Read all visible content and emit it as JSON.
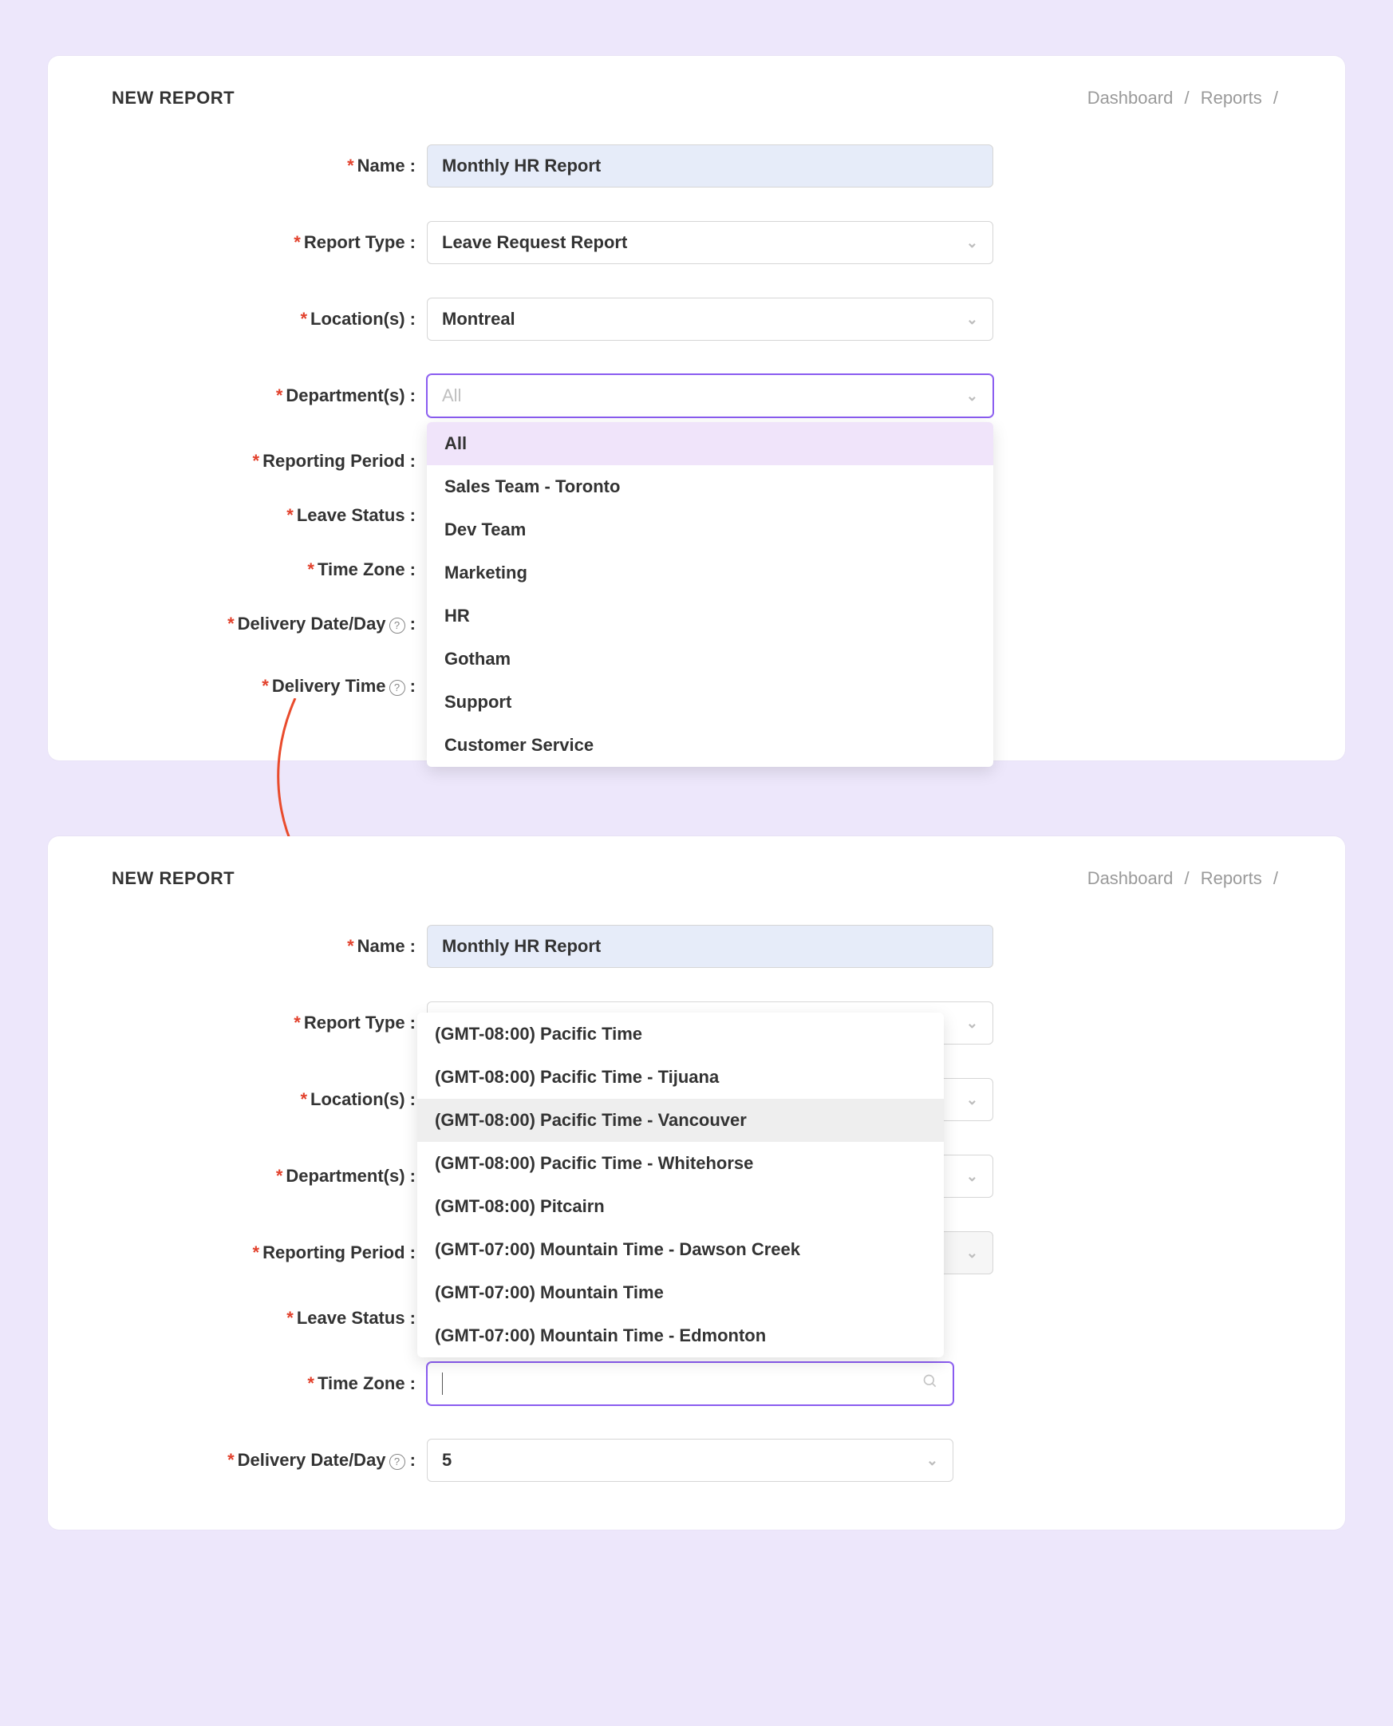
{
  "page_title": "NEW REPORT",
  "breadcrumb": {
    "a": "Dashboard",
    "sep": "/",
    "b": "Reports"
  },
  "labels": {
    "name": "Name :",
    "report_type": "Report Type :",
    "locations": "Location(s) :",
    "departments": "Department(s) :",
    "reporting_period": "Reporting Period :",
    "leave_status": "Leave Status :",
    "time_zone": "Time Zone :",
    "delivery_date": "Delivery Date/Day",
    "delivery_time": "Delivery Time"
  },
  "panel1": {
    "name_value": "Monthly HR Report",
    "report_type_value": "Leave Request Report",
    "locations_value": "Montreal",
    "departments_placeholder": "All",
    "department_options": [
      "All",
      "Sales Team - Toronto",
      "Dev Team",
      "Marketing",
      "HR",
      "Gotham",
      "Support",
      "Customer Service"
    ],
    "selected_department_index": 0
  },
  "panel2": {
    "name_value": "Monthly HR Report",
    "timezone_options": [
      "(GMT-08:00) Pacific Time",
      "(GMT-08:00) Pacific Time - Tijuana",
      "(GMT-08:00) Pacific Time - Vancouver",
      "(GMT-08:00) Pacific Time - Whitehorse",
      "(GMT-08:00) Pitcairn",
      "(GMT-07:00) Mountain Time - Dawson Creek",
      "(GMT-07:00) Mountain Time",
      "(GMT-07:00) Mountain Time - Edmonton"
    ],
    "hover_timezone_index": 2,
    "delivery_date_value": "5"
  }
}
